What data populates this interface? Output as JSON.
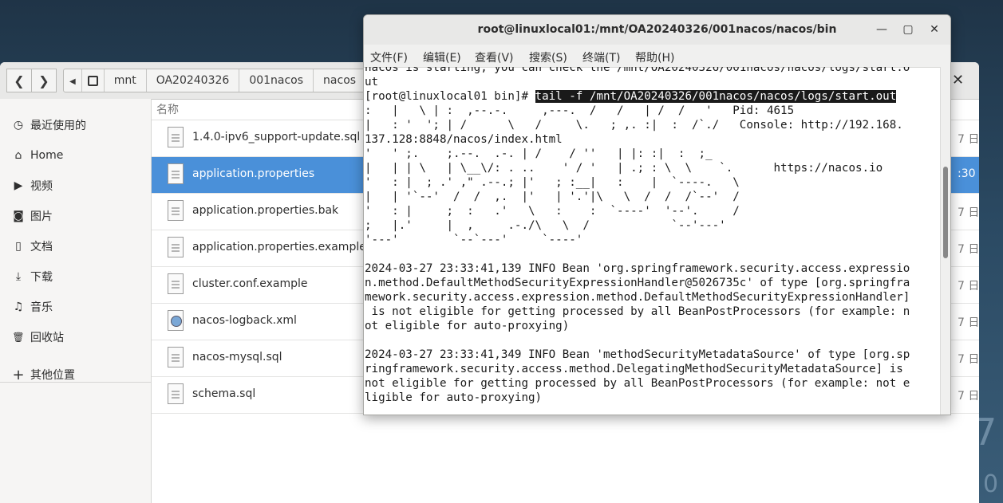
{
  "desktop": {
    "deco1": "7",
    "deco2": "0"
  },
  "file_manager": {
    "nav": {
      "back_icon": "chevron-left-icon",
      "forward_icon": "chevron-right-icon"
    },
    "breadcrumbs": [
      "mnt",
      "OA20240326",
      "001nacos",
      "nacos"
    ],
    "sidebar": [
      {
        "icon": "clock-icon",
        "glyph": "◷",
        "label": "最近使用的"
      },
      {
        "icon": "home-icon",
        "glyph": "⌂",
        "label": "Home"
      },
      {
        "icon": "video-icon",
        "glyph": "▶",
        "label": "视频"
      },
      {
        "icon": "camera-icon",
        "glyph": "◙",
        "label": "图片"
      },
      {
        "icon": "document-icon",
        "glyph": "▯",
        "label": "文档"
      },
      {
        "icon": "download-icon",
        "glyph": "⤓",
        "label": "下载"
      },
      {
        "icon": "music-icon",
        "glyph": "♫",
        "label": "音乐"
      },
      {
        "icon": "trash-icon",
        "glyph": "🗑",
        "label": "回收站"
      },
      {
        "icon": "plus-icon",
        "glyph": "+",
        "label": "其他位置"
      }
    ],
    "column_name": "名称",
    "files": [
      {
        "name": "1.4.0-ipv6_support-update.sql",
        "date": "7 日"
      },
      {
        "name": "application.properties",
        "date": ":30"
      },
      {
        "name": "application.properties.bak",
        "date": "7 日"
      },
      {
        "name": "application.properties.example",
        "date": "7 日"
      },
      {
        "name": "cluster.conf.example",
        "date": "7 日"
      },
      {
        "name": "nacos-logback.xml",
        "date": "7 日"
      },
      {
        "name": "nacos-mysql.sql",
        "date": "7 日"
      },
      {
        "name": "schema.sql",
        "date": "7 日"
      }
    ],
    "close_glyph": "✕"
  },
  "terminal": {
    "title": "root@linuxlocal01:/mnt/OA20240326/001nacos/nacos/bin",
    "window_buttons": {
      "minimize": "—",
      "maximize": "▢",
      "close": "✕"
    },
    "menu": [
      "文件(F)",
      "编辑(E)",
      "查看(V)",
      "搜索(S)",
      "终端(T)",
      "帮助(H)"
    ],
    "lines": [
      "nacos is starting, you can check the /mnt/OA20240326/001nacos/nacos/logs/start.o",
      "ut",
      "[root@linuxlocal01 bin]# ",
      ":   |   \\ | :  ,--.-.     ,---.  /   /   | /  /   '   Pid: 4615",
      "|   : '  '; | /      \\   /     \\.   ; ,. :|  :  /`./   Console: http://192.168.",
      "137.128:8848/nacos/index.html",
      "'   ' ;.    ;.--.  .-. | /    / ''   | |: :|  :  ;_",
      "|   | | \\   | \\__\\/: . ..    ' / '   | .; : \\  \\    `.      https://nacos.io",
      "'   : |  ; .' ,\" .--.; |'   ; :__|   :    |  `----.   \\",
      "|   | '`--'  /  /  ,.  |'   | '.'|\\   \\  /  /  /`--'  /",
      "'   : |     ;  :   .'   \\   :    :  `----'  '--'.     /",
      ";   |.'     |  ,     .-./\\   \\  /            `--'---'",
      "'---'        `--`---'     `----'",
      "",
      "2024-03-27 23:33:41,139 INFO Bean 'org.springframework.security.access.expressio",
      "n.method.DefaultMethodSecurityExpressionHandler@5026735c' of type [org.springfra",
      "mework.security.access.expression.method.DefaultMethodSecurityExpressionHandler]",
      " is not eligible for getting processed by all BeanPostProcessors (for example: n",
      "ot eligible for auto-proxying)",
      "",
      "2024-03-27 23:33:41,349 INFO Bean 'methodSecurityMetadataSource' of type [org.sp",
      "ringframework.security.access.method.DelegatingMethodSecurityMetadataSource] is",
      "not eligible for getting processed by all BeanPostProcessors (for example: not e",
      "ligible for auto-proxying)"
    ],
    "command": "tail -f /mnt/OA20240326/001nacos/nacos/logs/start.out"
  }
}
